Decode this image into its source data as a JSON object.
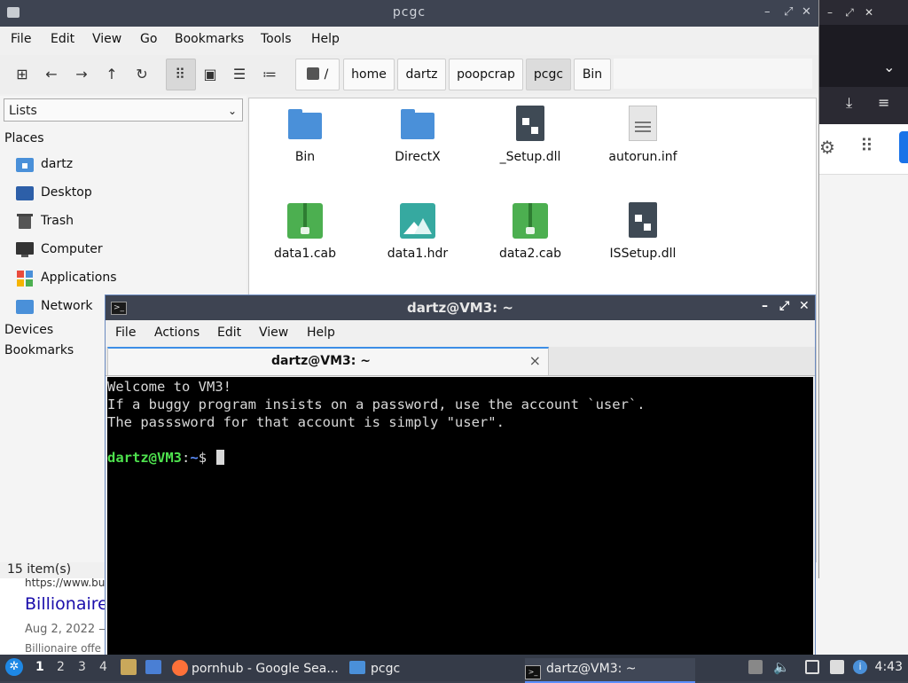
{
  "file_manager": {
    "title": "pcgc",
    "menu": [
      "File",
      "Edit",
      "View",
      "Go",
      "Bookmarks",
      "Tools",
      "Help"
    ],
    "breadcrumb": {
      "root": "/",
      "items": [
        "home",
        "dartz",
        "poopcrap",
        "pcgc",
        "Bin"
      ]
    },
    "side_panel": {
      "view_select": "Lists",
      "places_heading": "Places",
      "places": [
        "dartz",
        "Desktop",
        "Trash",
        "Computer",
        "Applications",
        "Network"
      ],
      "devices_heading": "Devices",
      "bookmarks_heading": "Bookmarks"
    },
    "files": [
      {
        "name": "Bin",
        "icon": "folder-icon"
      },
      {
        "name": "DirectX",
        "icon": "folder-icon"
      },
      {
        "name": "_Setup.dll",
        "icon": "library-icon"
      },
      {
        "name": "autorun.inf",
        "icon": "text-file-icon"
      },
      {
        "name": "data1.cab",
        "icon": "archive-icon"
      },
      {
        "name": "data1.hdr",
        "icon": "image-file-icon"
      },
      {
        "name": "data2.cab",
        "icon": "archive-icon"
      },
      {
        "name": "ISSetup.dll",
        "icon": "library-icon"
      }
    ],
    "status": "15 item(s)"
  },
  "terminal": {
    "title": "dartz@VM3: ~",
    "menu": [
      "File",
      "Actions",
      "Edit",
      "View",
      "Help"
    ],
    "tab_label": "dartz@VM3: ~",
    "lines": [
      "Welcome to VM3!",
      "If a buggy program insists on a password, use the account `user`.",
      "The passsword for that account is simply \"user\"."
    ],
    "prompt": {
      "user_host": "dartz@VM3",
      "sep": ":",
      "path": "~",
      "symbol": "$"
    }
  },
  "background_page": {
    "url": "https://www.bu",
    "title": "Billionaire",
    "date": "Aug 2, 2022 —",
    "snippet": "Billionaire offe"
  },
  "taskbar": {
    "workspaces": [
      "1",
      "2",
      "3",
      "4"
    ],
    "active_workspace": "1",
    "tasks": [
      {
        "label": "pornhub - Google Sea...",
        "icon": "firefox-icon"
      },
      {
        "label": "pcgc",
        "icon": "folder-icon"
      },
      {
        "label": "dartz@VM3: ~",
        "icon": "terminal-icon"
      }
    ],
    "clock": "4:43"
  },
  "colors": {
    "titlebar": "#3e4452",
    "folder": "#4a90d9",
    "archive": "#4caf50",
    "prompt_user": "#4ee24e",
    "prompt_path": "#5c8fff",
    "accent": "#3d8ee6"
  }
}
